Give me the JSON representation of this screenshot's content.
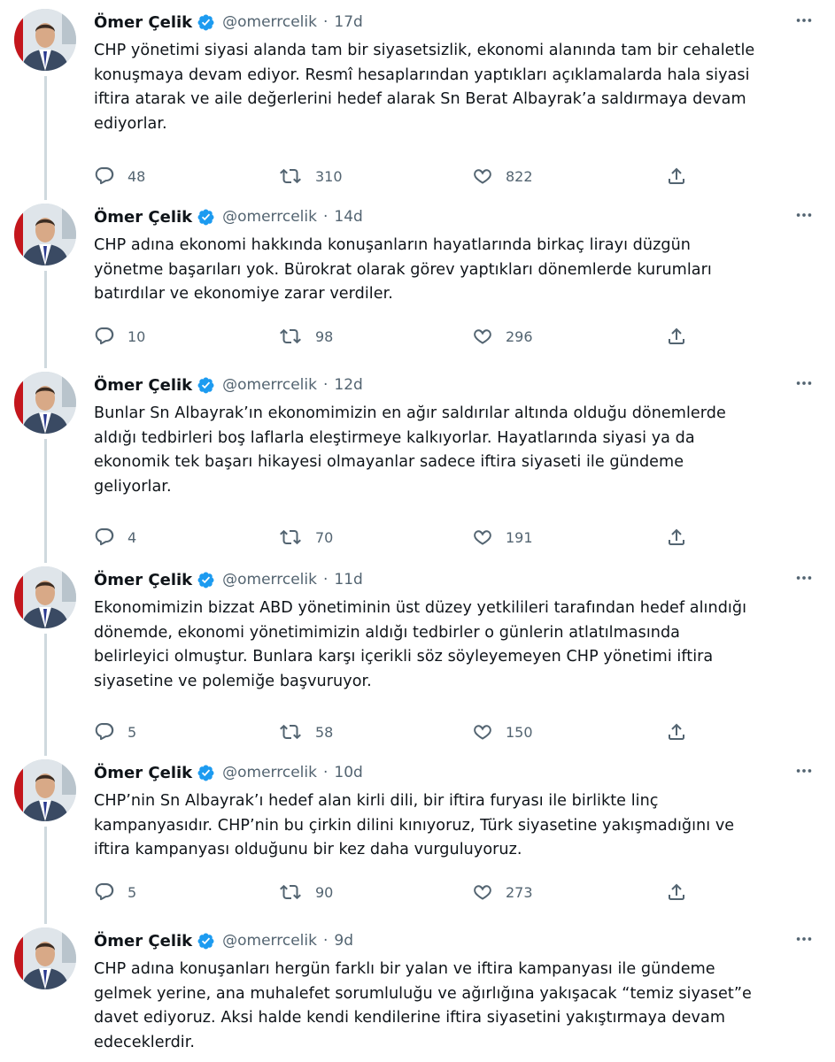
{
  "author": {
    "name": "Ömer Çelik",
    "handle": "@omerrcelik",
    "avatar_icon": "profile-photo",
    "verified_color": "#1d9bf0"
  },
  "tweets": [
    {
      "time": "17d",
      "lines": [
        "CHP yönetimi siyasi alanda tam bir siyasetsizlik, ekonomi alanında tam bir cehaletle",
        "konuşmaya devam ediyor. Resmî hesaplarından yaptıkları açıklamalarda hala siyasi",
        "iftira atarak ve aile değerlerini hedef alarak Sn Berat Albayrak’a saldırmaya devam",
        "ediyorlar."
      ],
      "replies": "48",
      "retweets": "310",
      "likes": "822"
    },
    {
      "time": "14d",
      "lines": [
        "CHP adına ekonomi hakkında konuşanların hayatlarında birkaç lirayı düzgün",
        "yönetme başarıları yok. Bürokrat olarak görev yaptıkları dönemlerde kurumları",
        "batırdılar ve ekonomiye zarar verdiler."
      ],
      "replies": "10",
      "retweets": "98",
      "likes": "296"
    },
    {
      "time": "12d",
      "lines": [
        "Bunlar Sn Albayrak’ın ekonomimizin en ağır saldırılar altında olduğu dönemlerde",
        "aldığı tedbirleri boş laflarla eleştirmeye kalkıyorlar. Hayatlarında siyasi ya da",
        "ekonomik tek başarı hikayesi olmayanlar sadece iftira siyaseti ile gündeme",
        "geliyorlar."
      ],
      "replies": "4",
      "retweets": "70",
      "likes": "191"
    },
    {
      "time": "11d",
      "lines": [
        "Ekonomimizin bizzat ABD yönetiminin üst düzey yetkilileri tarafından hedef alındığı",
        "dönemde, ekonomi yönetimimizin aldığı tedbirler o günlerin atlatılmasında",
        "belirleyici olmuştur. Bunlara karşı içerikli söz söyleyemeyen CHP yönetimi iftira",
        "siyasetine ve polemiğe başvuruyor."
      ],
      "replies": "5",
      "retweets": "58",
      "likes": "150"
    },
    {
      "time": "10d",
      "lines": [
        "CHP’nin Sn Albayrak’ı hedef alan kirli dili, bir iftira furyası ile birlikte linç",
        "kampanyasıdır. CHP’nin bu çirkin dilini kınıyoruz, Türk siyasetine yakışmadığını ve",
        "iftira kampanyası olduğunu bir kez daha vurguluyoruz."
      ],
      "replies": "5",
      "retweets": "90",
      "likes": "273"
    },
    {
      "time": "9d",
      "lines": [
        "CHP adına konuşanları hergün farklı bir yalan ve iftira kampanyası ile gündeme",
        "gelmek yerine, ana muhalefet sorumluluğu ve ağırlığına yakışacak “temiz siyaset”e",
        "davet ediyoruz. Aksi halde kendi kendilerine iftira siyasetini yakıştırmaya devam",
        "edeceklerdir."
      ],
      "replies": null,
      "retweets": null,
      "likes": null
    }
  ],
  "separator": "·"
}
